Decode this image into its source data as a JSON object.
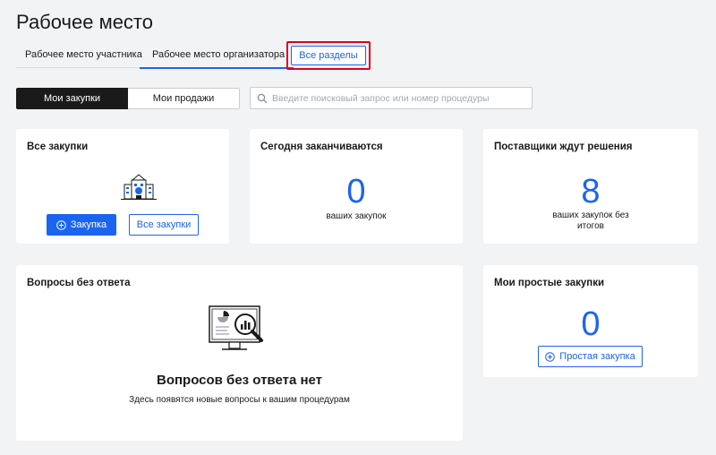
{
  "page": {
    "title": "Рабочее место"
  },
  "tabs": [
    {
      "label": "Рабочее место участника"
    },
    {
      "label": "Рабочее место организатора"
    }
  ],
  "all_sections_label": "Все разделы",
  "segment": {
    "my_purchases": "Мои закупки",
    "my_sales": "Мои продажи"
  },
  "search": {
    "placeholder": "Введите поисковый запрос или номер процедуры"
  },
  "cards": {
    "all_purchases": {
      "title": "Все закупки",
      "primary_button": "Закупка",
      "secondary_button": "Все закупки"
    },
    "ending_today": {
      "title": "Сегодня заканчиваются",
      "count": "0",
      "caption": "ваших закупок"
    },
    "suppliers_waiting": {
      "title": "Поставщики ждут решения",
      "count": "8",
      "caption_line1": "ваших закупок без",
      "caption_line2": "итогов"
    },
    "unanswered_questions": {
      "title": "Вопросы без ответа",
      "empty_title": "Вопросов без ответа нет",
      "empty_subtitle": "Здесь появятся новые вопросы к вашим процедурам"
    },
    "simple_purchases": {
      "title": "Мои простые закупки",
      "count": "0",
      "button": "Простая закупка"
    }
  },
  "colors": {
    "accent": "#1b64f0",
    "highlight_border": "#e0001b",
    "background": "#f2f3f5"
  }
}
